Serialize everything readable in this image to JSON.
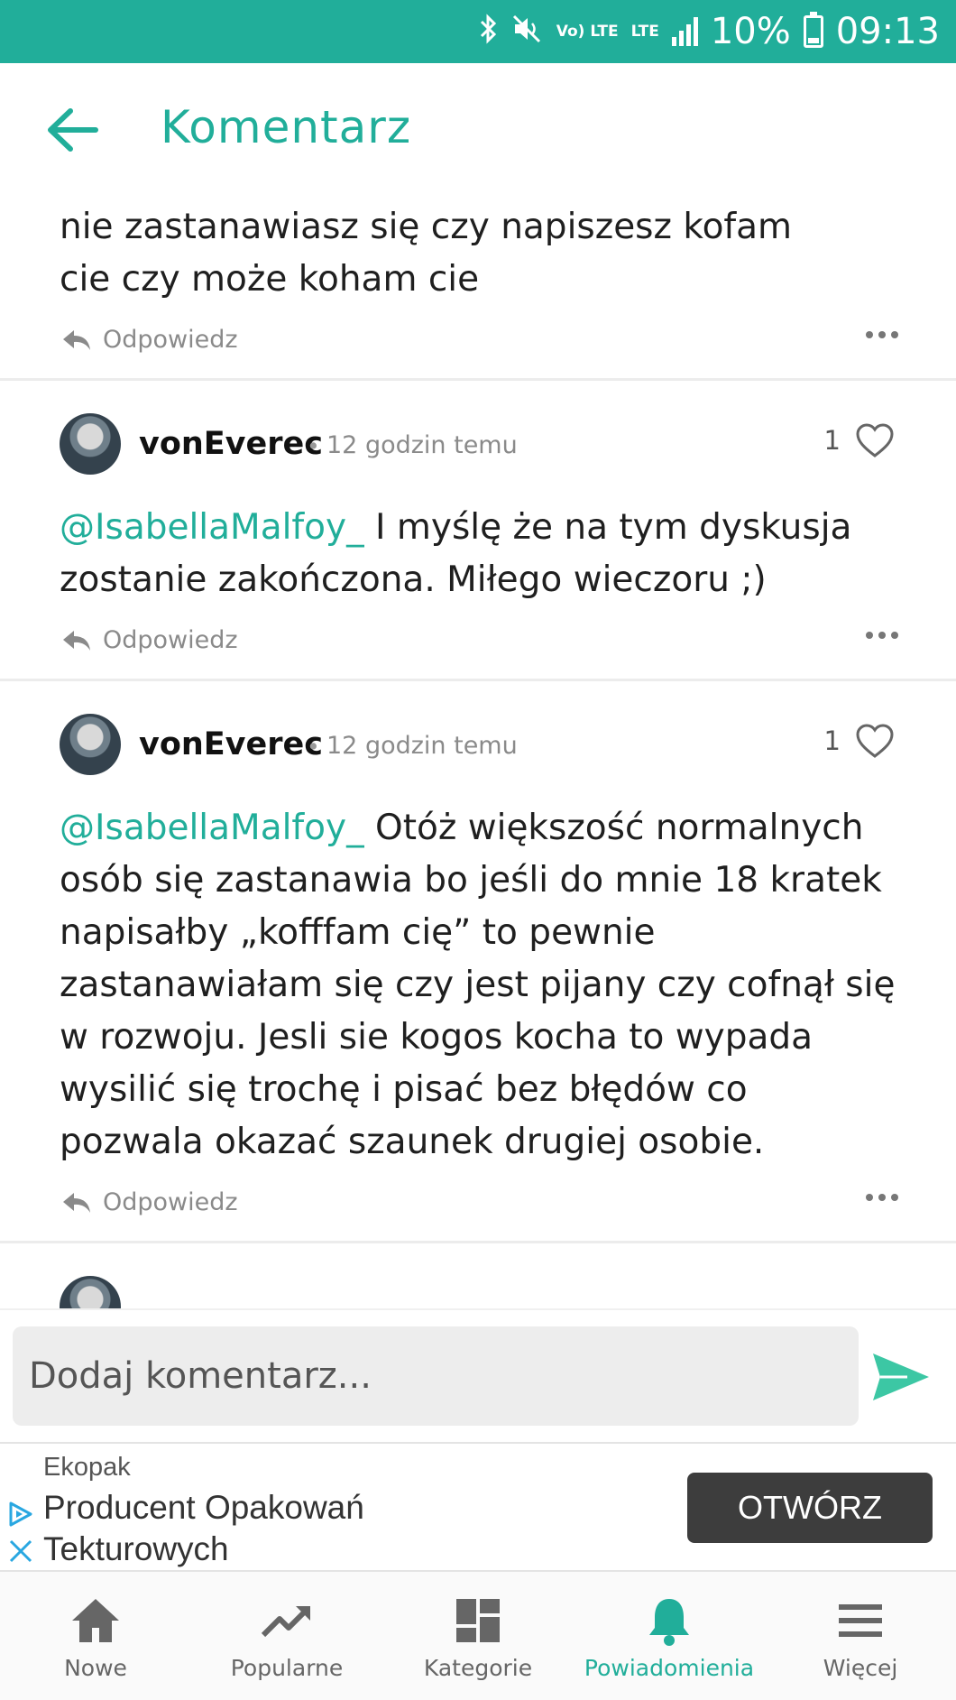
{
  "status_bar": {
    "icons": [
      "bluetooth-icon",
      "mute-icon",
      "volte-icon",
      "lte-icon",
      "signal-icon",
      "battery-icon"
    ],
    "volte_label": "Vo) LTE",
    "lte_label": "LTE",
    "battery": "10%",
    "time": "09:13"
  },
  "header": {
    "title": "Komentarz",
    "back_icon": "arrow-left-icon",
    "accent_color": "#21ae9a"
  },
  "partial_comment": {
    "text": "nie zastanawiasz się czy napiszesz kofam cie czy może koham cie",
    "reply_label": "Odpowiedz"
  },
  "comments": [
    {
      "author": "vonEverec",
      "separator": "•",
      "time": "12 godzin temu",
      "likes": "1",
      "mention": "@IsabellaMalfoy_",
      "text": " I myślę że na tym dyskusja zostanie zakończona. Miłego wieczoru ;)",
      "reply_label": "Odpowiedz"
    },
    {
      "author": "vonEverec",
      "separator": "•",
      "time": "12 godzin temu",
      "likes": "1",
      "mention": "@IsabellaMalfoy_",
      "text": " Otóż większość normalnych osób się zastanawia bo jeśli do mnie 18 kratek napisałby „kofffam cię” to pewnie zastanawiałam się czy jest pijany czy cofnął się w rozwoju. Jesli sie kogos kocha to wypada wysilić się trochę i pisać bez błędów co pozwala okazać szaunek drugiej osobie.",
      "reply_label": "Odpowiedz"
    }
  ],
  "comment_input": {
    "placeholder": "Dodaj komentarz...",
    "value": ""
  },
  "ad": {
    "brand": "Ekopak",
    "headline": "Producent Opakowań Tekturowych",
    "cta": "OTWÓRZ"
  },
  "bottom_nav": {
    "items": [
      {
        "label": "Nowe",
        "icon": "home-icon"
      },
      {
        "label": "Popularne",
        "icon": "trending-icon"
      },
      {
        "label": "Kategorie",
        "icon": "dashboard-icon"
      },
      {
        "label": "Powiadomienia",
        "icon": "bell-icon"
      },
      {
        "label": "Więcej",
        "icon": "menu-icon"
      }
    ],
    "active": "Powiadomienia"
  }
}
